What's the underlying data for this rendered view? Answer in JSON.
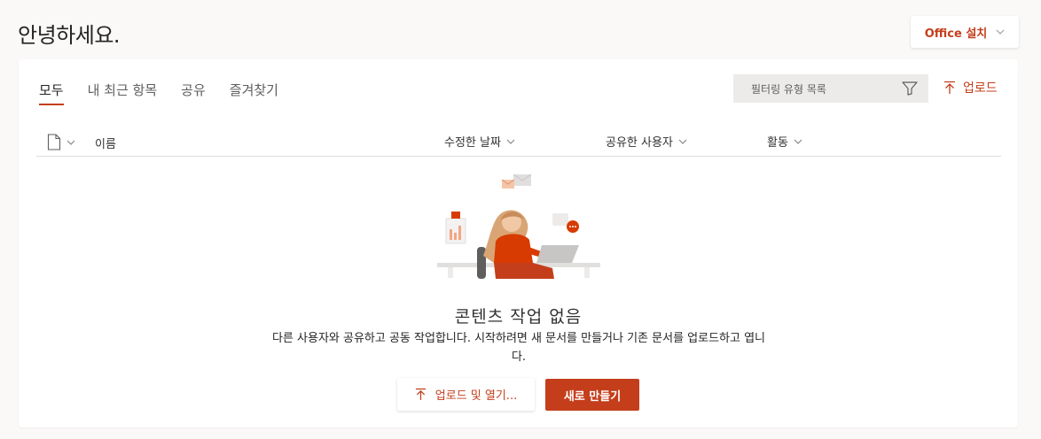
{
  "header": {
    "greeting": "안녕하세요.",
    "install_button": "Office 설치"
  },
  "tabs": [
    {
      "label": "모두",
      "active": true
    },
    {
      "label": "내 최근 항목",
      "active": false
    },
    {
      "label": "공유",
      "active": false
    },
    {
      "label": "즐겨찾기",
      "active": false
    }
  ],
  "filter": {
    "placeholder": "필터링 유형 목록"
  },
  "upload": {
    "label": "업로드"
  },
  "columns": {
    "name": "이름",
    "modified": "수정한 날짜",
    "shared_by": "공유한 사용자",
    "activity": "활동"
  },
  "empty_state": {
    "title": "콘텐츠 작업 없음",
    "description": "다른 사용자와 공유하고 공동 작업합니다. 시작하려면 새 문서를 만들거나 기존 문서를 업로드하고 엽니다.",
    "upload_open_button": "업로드 및 열기...",
    "new_button": "새로 만들기"
  },
  "colors": {
    "accent": "#c43e1c",
    "background": "#faf9f8"
  }
}
